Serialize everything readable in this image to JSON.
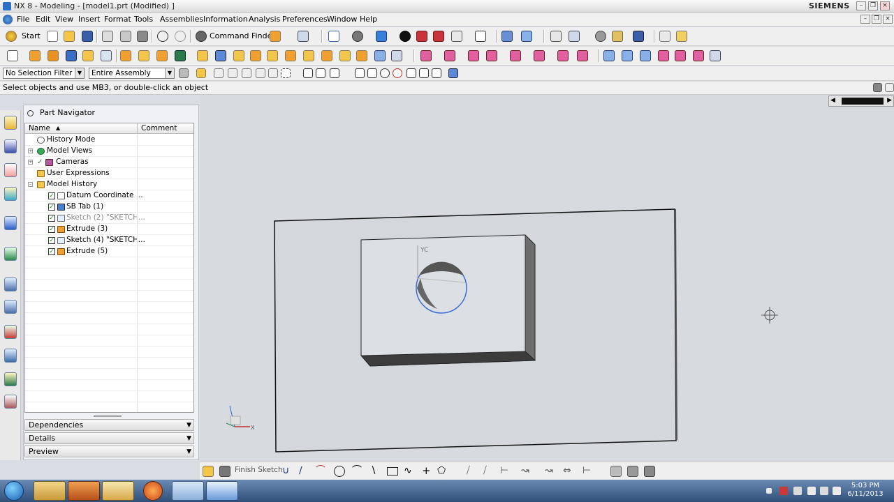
{
  "window": {
    "title": "NX 8 - Modeling - [model1.prt (Modified) ]",
    "brand": "SIEMENS",
    "controls": [
      "minimize",
      "restore",
      "close"
    ]
  },
  "menubar": {
    "items": [
      "File",
      "Edit",
      "View",
      "Insert",
      "Format",
      "Tools",
      "Assemblies",
      "Information",
      "Analysis",
      "Preferences",
      "Window",
      "Help"
    ]
  },
  "toolbar": {
    "start_label": "Start",
    "command_finder_label": "Command Finder"
  },
  "selection_bar": {
    "filter": "No Selection Filter",
    "scope": "Entire Assembly"
  },
  "cue_line": "Select objects and use MB3, or double-click an object",
  "part_navigator": {
    "title": "Part Navigator",
    "columns": [
      "Name",
      "Comment"
    ],
    "rows": [
      {
        "label": "History Mode",
        "icon": "clock-icon"
      },
      {
        "label": "Model Views",
        "icon": "globe-icon"
      },
      {
        "label": "Cameras",
        "icon": "camera-icon"
      },
      {
        "label": "User Expressions",
        "icon": "folder-icon"
      },
      {
        "label": "Model History",
        "icon": "folder-icon"
      },
      {
        "label": "Datum Coordinate ...",
        "icon": "datum-csys-icon"
      },
      {
        "label": "SB Tab (1)",
        "icon": "tab-feature-icon"
      },
      {
        "label": "Sketch (2) \"SKETCH...",
        "icon": "sketch-icon"
      },
      {
        "label": "Extrude (3)",
        "icon": "extrude-icon"
      },
      {
        "label": "Sketch (4) \"SKETCH...",
        "icon": "sketch-icon"
      },
      {
        "label": "Extrude (5)",
        "icon": "extrude-icon"
      }
    ],
    "sections": [
      "Dependencies",
      "Details",
      "Preview"
    ]
  },
  "viewport": {
    "csys_labels": {
      "yc": "YC",
      "x": "X"
    }
  },
  "sketch_toolbar": {
    "finish_label": "Finish Sketch"
  },
  "taskbar": {
    "time": "5:03 PM",
    "date": "6/11/2013"
  },
  "colors": {
    "sheet_edge": "#000000",
    "circle_highlight": "#3b6fd8",
    "taskbar_top": "#6b8bb3"
  }
}
